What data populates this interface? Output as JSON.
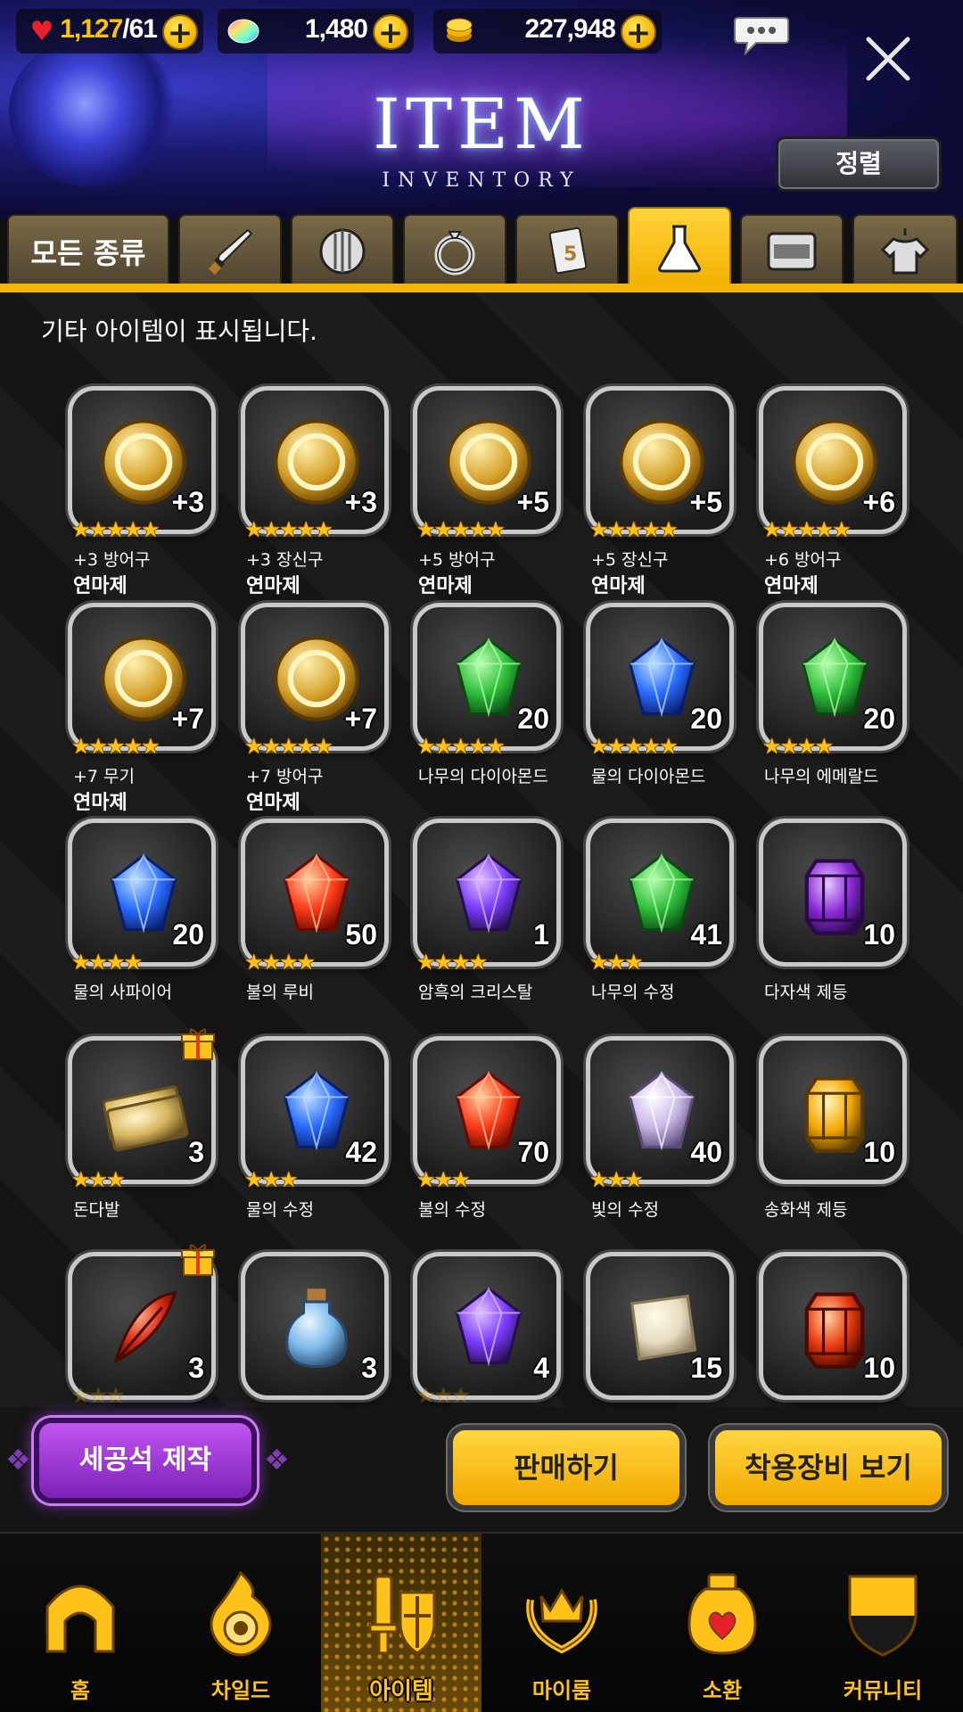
{
  "resources": {
    "hearts": {
      "current": "1,127",
      "max": "/61"
    },
    "gems": "1,480",
    "gold": "227,948"
  },
  "header": {
    "title": "ITEM",
    "subtitle": "INVENTORY",
    "sort_label": "정렬"
  },
  "tabs": [
    {
      "label": "모든 종류",
      "icon": "all"
    },
    {
      "icon": "sword-icon"
    },
    {
      "icon": "shield-icon"
    },
    {
      "icon": "ring-icon"
    },
    {
      "icon": "card-icon"
    },
    {
      "icon": "flask-icon",
      "active": true
    },
    {
      "icon": "card-frame-icon"
    },
    {
      "icon": "shirt-icon"
    }
  ],
  "info_text": "기타 아이템이 표시됩니다.",
  "items": [
    {
      "label": "+3",
      "stars": 5,
      "name": "+3 방어구",
      "name2": "연마제",
      "kind": "gold"
    },
    {
      "label": "+3",
      "stars": 5,
      "name": "+3 장신구",
      "name2": "연마제",
      "kind": "gold"
    },
    {
      "label": "+5",
      "stars": 5,
      "name": "+5 방어구",
      "name2": "연마제",
      "kind": "gold"
    },
    {
      "label": "+5",
      "stars": 5,
      "name": "+5 장신구",
      "name2": "연마제",
      "kind": "gold"
    },
    {
      "label": "+6",
      "stars": 5,
      "name": "+6 방어구",
      "name2": "연마제",
      "kind": "gold"
    },
    {
      "label": "+7",
      "stars": 5,
      "name": "+7 무기",
      "name2": "연마제",
      "kind": "gold"
    },
    {
      "label": "+7",
      "stars": 5,
      "name": "+7 방어구",
      "name2": "연마제",
      "kind": "gold"
    },
    {
      "label": "20",
      "stars": 5,
      "name": "나무의 다이아몬드",
      "kind": "green"
    },
    {
      "label": "20",
      "stars": 5,
      "name": "물의 다이아몬드",
      "kind": "blue"
    },
    {
      "label": "20",
      "stars": 4,
      "name": "나무의 에메랄드",
      "kind": "green"
    },
    {
      "label": "20",
      "stars": 4,
      "name": "물의 사파이어",
      "kind": "blue"
    },
    {
      "label": "50",
      "stars": 4,
      "name": "불의 루비",
      "kind": "red"
    },
    {
      "label": "1",
      "stars": 4,
      "name": "암흑의 크리스탈",
      "kind": "purple"
    },
    {
      "label": "41",
      "stars": 3,
      "name": "나무의 수정",
      "kind": "green"
    },
    {
      "label": "10",
      "stars": 0,
      "name": "다자색 제등",
      "kind": "lantern-purple"
    },
    {
      "label": "3",
      "stars": 3,
      "name": "돈다발",
      "kind": "money",
      "gift": true
    },
    {
      "label": "42",
      "stars": 3,
      "name": "물의 수정",
      "kind": "blue"
    },
    {
      "label": "70",
      "stars": 3,
      "name": "불의 수정",
      "kind": "red"
    },
    {
      "label": "40",
      "stars": 3,
      "name": "빛의 수정",
      "kind": "white"
    },
    {
      "label": "10",
      "stars": 0,
      "name": "송화색 제등",
      "kind": "lantern-gold"
    },
    {
      "label": "3",
      "stars": 3,
      "name": "",
      "kind": "feather",
      "gift": true
    },
    {
      "label": "3",
      "stars": 0,
      "name": "",
      "kind": "bottle"
    },
    {
      "label": "4",
      "stars": 3,
      "name": "",
      "kind": "purple"
    },
    {
      "label": "15",
      "stars": 0,
      "name": "",
      "kind": "scroll"
    },
    {
      "label": "10",
      "stars": 0,
      "name": "",
      "kind": "lantern-red"
    }
  ],
  "actions": {
    "craft": "세공석 제작",
    "sell": "판매하기",
    "equip": "착용장비 보기"
  },
  "nav": [
    {
      "label": "홈",
      "icon": "home-icon"
    },
    {
      "label": "차일드",
      "icon": "child-icon"
    },
    {
      "label": "아이템",
      "icon": "item-icon",
      "active": true
    },
    {
      "label": "마이룸",
      "icon": "myroom-icon"
    },
    {
      "label": "소환",
      "icon": "summon-icon"
    },
    {
      "label": "커뮤니티",
      "icon": "community-icon"
    }
  ],
  "colors": {
    "accent": "#f4b400",
    "craft": "#9e3bd8",
    "star": "#ffc21a"
  }
}
